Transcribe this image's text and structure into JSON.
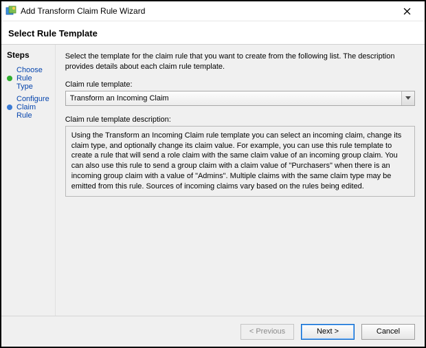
{
  "window": {
    "title": "Add Transform Claim Rule Wizard"
  },
  "header": {
    "subtitle": "Select Rule Template"
  },
  "sidebar": {
    "heading": "Steps",
    "items": [
      {
        "label": "Choose Rule Type"
      },
      {
        "label": "Configure Claim Rule"
      }
    ]
  },
  "content": {
    "intro": "Select the template for the claim rule that you want to create from the following list. The description provides details about each claim rule template.",
    "template_label": "Claim rule template:",
    "template_selected": "Transform an Incoming Claim",
    "description_label": "Claim rule template description:",
    "description_text": "Using the Transform an Incoming Claim rule template you can select an incoming claim, change its claim type, and optionally change its claim value.  For example, you can use this rule template to create a rule that will send a role claim with the same claim value of an incoming group claim.  You can also use this rule to send a group claim with a claim value of \"Purchasers\" when there is an incoming group claim with a value of \"Admins\".  Multiple claims with the same claim type may be emitted from this rule.  Sources of incoming claims vary based on the rules being edited."
  },
  "footer": {
    "previous": "< Previous",
    "next": "Next >",
    "cancel": "Cancel"
  }
}
